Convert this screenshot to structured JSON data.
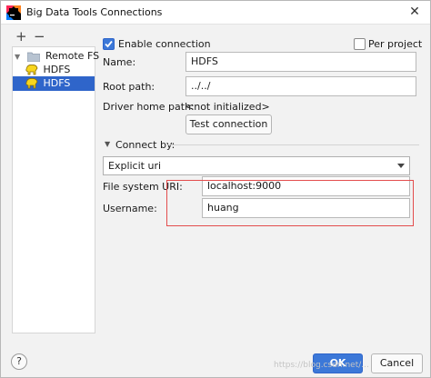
{
  "window": {
    "title": "Big Data Tools Connections",
    "close_glyph": "✕"
  },
  "toolbar": {
    "add_glyph": "+",
    "remove_glyph": "−"
  },
  "tree": {
    "root_label": "Remote FS",
    "child_label": "HDFS",
    "selected_label": "HDFS"
  },
  "form": {
    "enable_label": "Enable connection",
    "enable_checked": true,
    "per_project_label": "Per project",
    "per_project_checked": false,
    "name_label": "Name:",
    "name_value": "HDFS",
    "root_label": "Root path:",
    "root_value": "../../",
    "driver_label": "Driver home path:",
    "driver_value": "<not initialized>",
    "test_button": "Test connection",
    "connect_by_label": "Connect by:",
    "connect_by_value": "Explicit uri",
    "fs_uri_label": "File system URI:",
    "fs_uri_value": "localhost:9000",
    "username_label": "Username:",
    "username_value": "huang"
  },
  "footer": {
    "help_glyph": "?",
    "ok_label": "OK",
    "cancel_label": "Cancel",
    "watermark": "https://blog.csdn.net/..."
  },
  "colors": {
    "accent": "#3c78d8",
    "selection": "#2f65ca",
    "highlight_box": "#e34d4d"
  }
}
